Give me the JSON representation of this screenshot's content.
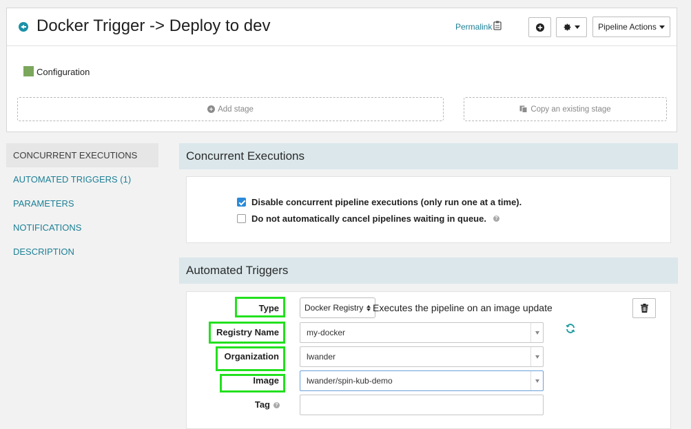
{
  "header": {
    "title": "Docker Trigger -> Deploy to dev",
    "permalink_label": "Permalink",
    "pipeline_actions_label": "Pipeline Actions"
  },
  "configuration": {
    "label": "Configuration",
    "swatch_color": "#7ba75c"
  },
  "stages": {
    "add_stage_label": "Add stage",
    "copy_stage_label": "Copy an existing stage"
  },
  "nav": {
    "items": [
      {
        "label": "CONCURRENT EXECUTIONS",
        "active": true
      },
      {
        "label": "AUTOMATED TRIGGERS (1)",
        "active": false
      },
      {
        "label": "PARAMETERS",
        "active": false
      },
      {
        "label": "NOTIFICATIONS",
        "active": false
      },
      {
        "label": "DESCRIPTION",
        "active": false
      }
    ]
  },
  "concurrent": {
    "heading": "Concurrent Executions",
    "disable_concurrent": {
      "label": "Disable concurrent pipeline executions (only run one at a time).",
      "checked": true
    },
    "no_cancel": {
      "label": "Do not automatically cancel pipelines waiting in queue.",
      "checked": false
    }
  },
  "triggers": {
    "heading": "Automated Triggers",
    "type": {
      "label": "Type",
      "value": "Docker Registry",
      "description": "Executes the pipeline on an image update"
    },
    "registry": {
      "label": "Registry Name",
      "value": "my-docker"
    },
    "organization": {
      "label": "Organization",
      "value": "lwander"
    },
    "image": {
      "label": "Image",
      "value": "lwander/spin-kub-demo"
    },
    "tag": {
      "label": "Tag",
      "value": ""
    }
  },
  "colors": {
    "accent": "#1b7f95",
    "highlight": "#22e01e",
    "section_header_bg": "#dbe7eb"
  }
}
